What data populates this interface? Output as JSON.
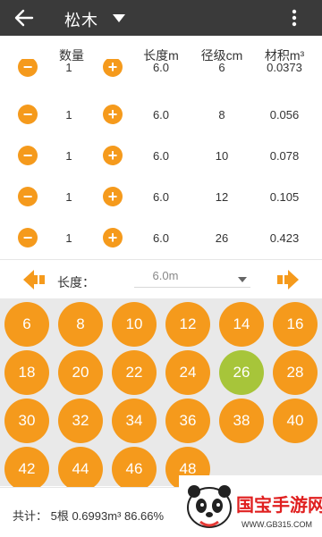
{
  "app": {
    "title": "松木"
  },
  "columns": {
    "count": "数量",
    "length": "长度m",
    "diameter": "径级cm",
    "volume": "材积m³"
  },
  "rows": [
    {
      "count": "1",
      "length": "6.0",
      "diameter": "6",
      "volume": "0.0373"
    },
    {
      "count": "1",
      "length": "6.0",
      "diameter": "8",
      "volume": "0.056"
    },
    {
      "count": "1",
      "length": "6.0",
      "diameter": "10",
      "volume": "0.078"
    },
    {
      "count": "1",
      "length": "6.0",
      "diameter": "12",
      "volume": "0.105"
    },
    {
      "count": "1",
      "length": "6.0",
      "diameter": "26",
      "volume": "0.423"
    }
  ],
  "length_selector": {
    "label": "长度：",
    "value": "6.0m"
  },
  "diameters": [
    "6",
    "8",
    "10",
    "12",
    "14",
    "16",
    "18",
    "20",
    "22",
    "24",
    "26",
    "28",
    "30",
    "32",
    "34",
    "36",
    "38",
    "40",
    "42",
    "44",
    "46",
    "48"
  ],
  "selected_diameter": "26",
  "summary": {
    "text": "共计：  5根 0.6993m³ 86.66%"
  },
  "watermark": {
    "title": "国宝手游网",
    "url": "WWW.GB315.COM"
  },
  "colors": {
    "appbar": "#3a3a3a",
    "accent": "#f59a1c",
    "selected": "#a7c53a",
    "grid_bg": "#e9e9e9"
  }
}
